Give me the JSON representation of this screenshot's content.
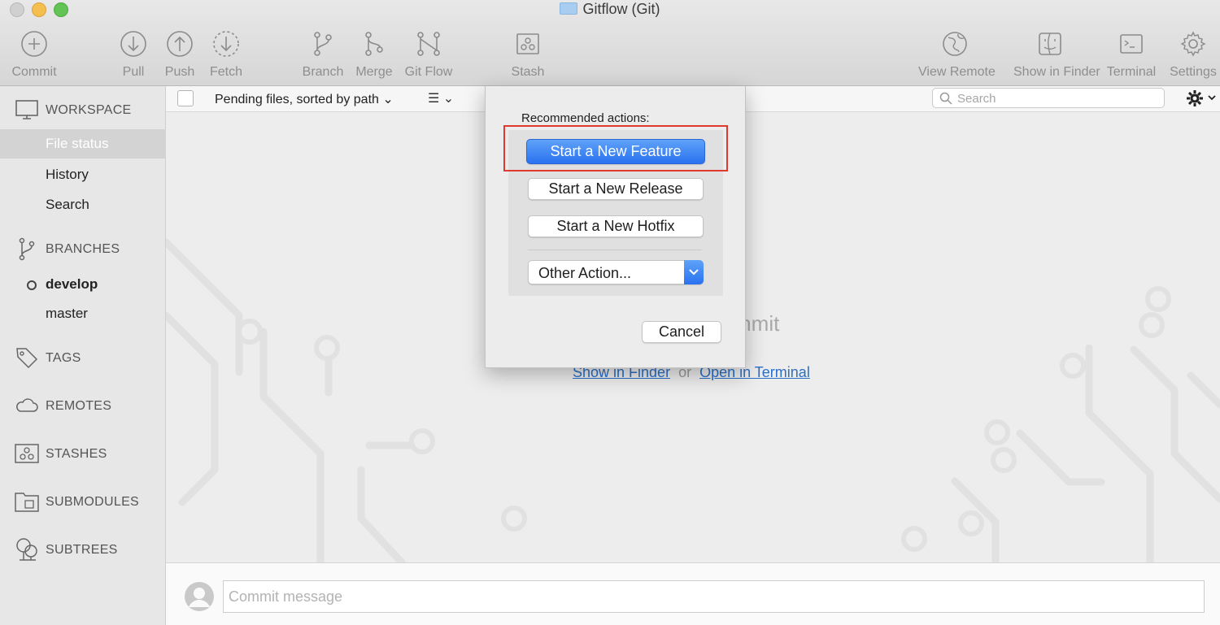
{
  "window": {
    "title": "Gitflow (Git)",
    "folder_icon": "folder-icon"
  },
  "toolbar": {
    "commit": "Commit",
    "pull": "Pull",
    "push": "Push",
    "fetch": "Fetch",
    "branch": "Branch",
    "merge": "Merge",
    "git_flow": "Git Flow",
    "stash": "Stash",
    "view_remote": "View Remote",
    "show_in_finder": "Show in Finder",
    "terminal": "Terminal",
    "settings": "Settings"
  },
  "sidebar": {
    "workspace": {
      "header": "WORKSPACE",
      "items": [
        "File status",
        "History",
        "Search"
      ],
      "selected": "File status"
    },
    "branches": {
      "header": "BRANCHES",
      "items": [
        "develop",
        "master"
      ],
      "current": "develop"
    },
    "tags": "TAGS",
    "remotes": "REMOTES",
    "stashes": "STASHES",
    "submodules": "SUBMODULES",
    "subtrees": "SUBTREES"
  },
  "filterbar": {
    "sort_label": "Pending files, sorted by path",
    "search_placeholder": "Search"
  },
  "main": {
    "empty_text": "mmit",
    "link_finder": "Show in Finder",
    "link_or": "or",
    "link_terminal": "Open in Terminal"
  },
  "commit": {
    "placeholder": "Commit message"
  },
  "dialog": {
    "title": "Recommended actions:",
    "buttons": {
      "new_feature": "Start a New Feature",
      "new_release": "Start a New Release",
      "new_hotfix": "Start a New Hotfix"
    },
    "other_action": "Other Action...",
    "cancel": "Cancel"
  },
  "colors": {
    "accent_blue": "#2a72f0",
    "highlight_red": "#e03a2f",
    "link_blue": "#2a6fc9"
  }
}
